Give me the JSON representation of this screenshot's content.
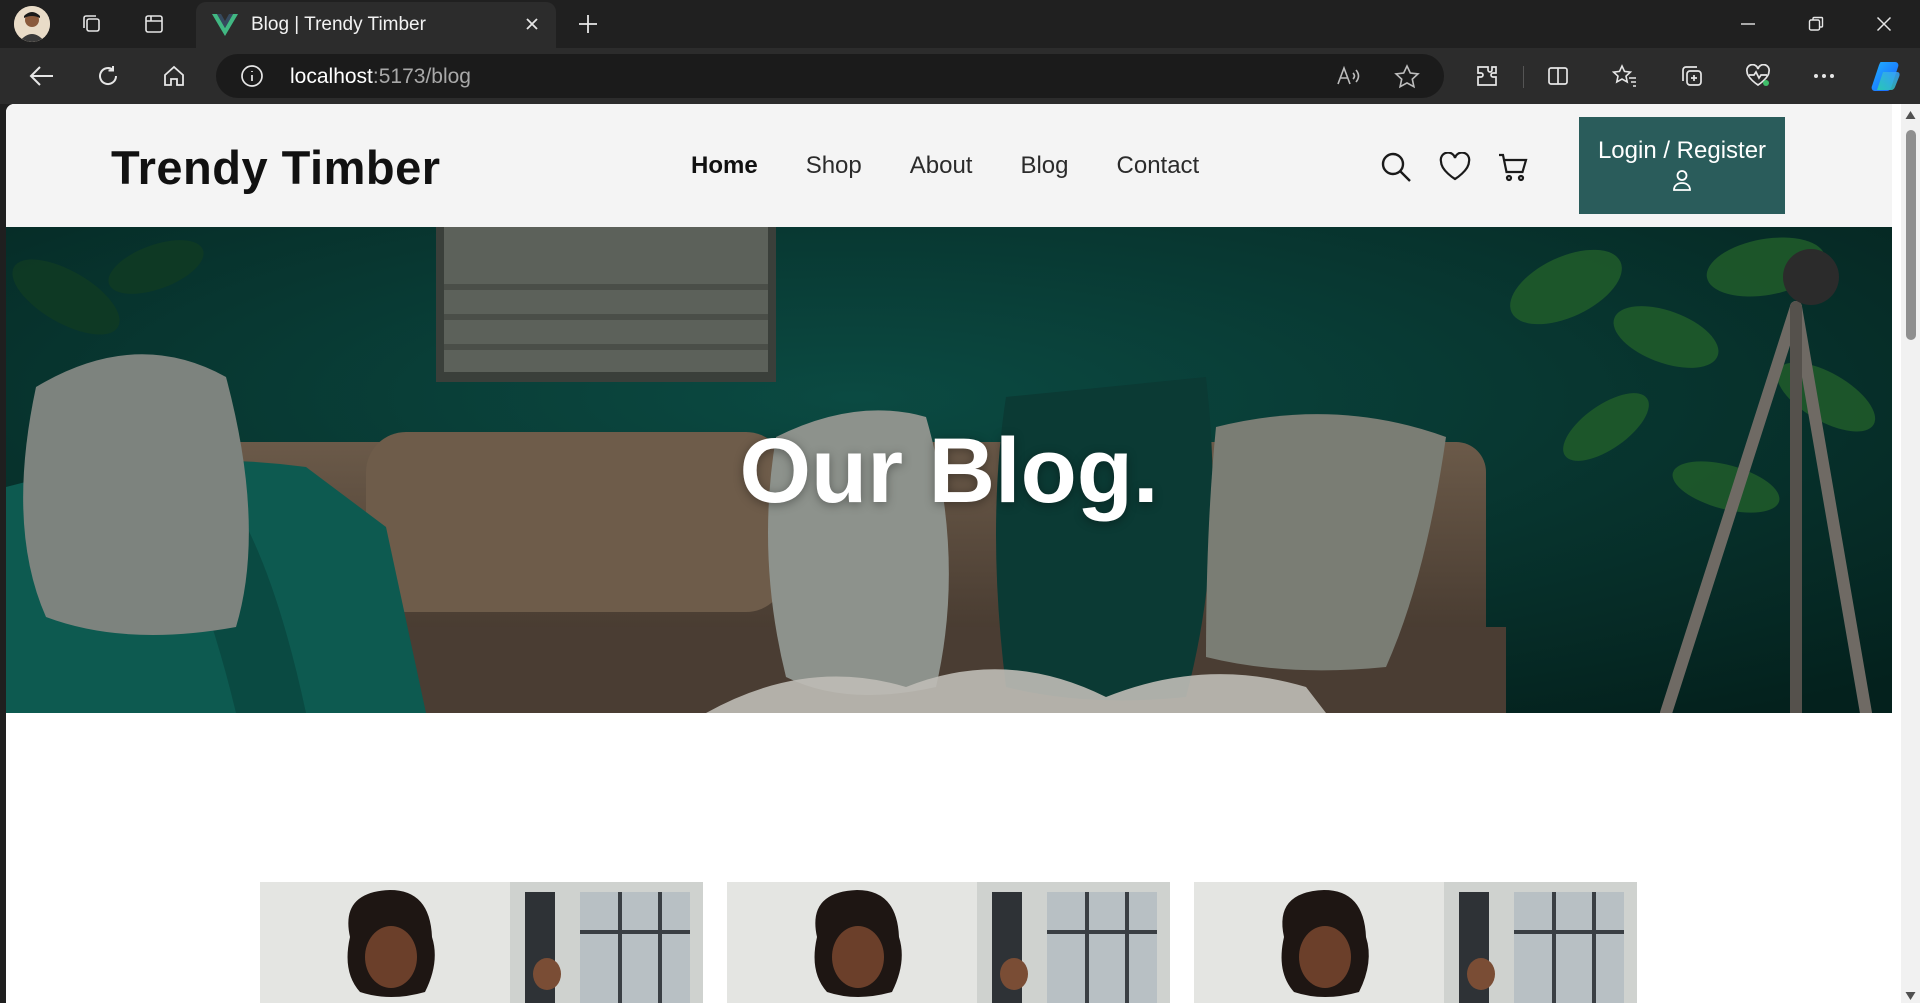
{
  "browser": {
    "tab": {
      "title": "Blog | Trendy Timber",
      "favicon": "vue-logo-icon"
    },
    "address": {
      "host": "localhost",
      "rest": ":5173/blog"
    }
  },
  "site": {
    "brand": "Trendy Timber",
    "nav": [
      {
        "label": "Home",
        "active": true
      },
      {
        "label": "Shop"
      },
      {
        "label": "About"
      },
      {
        "label": "Blog"
      },
      {
        "label": "Contact"
      }
    ],
    "header_icons": [
      "search-icon",
      "heart-icon",
      "cart-icon"
    ],
    "login_label": "Login / Register",
    "accent_color": "#2a5c5b"
  },
  "hero": {
    "title": "Our Blog."
  },
  "blog_cards": [
    {
      "image": "woman-with-headset-photo"
    },
    {
      "image": "woman-with-headset-photo"
    },
    {
      "image": "woman-with-headset-photo"
    }
  ]
}
